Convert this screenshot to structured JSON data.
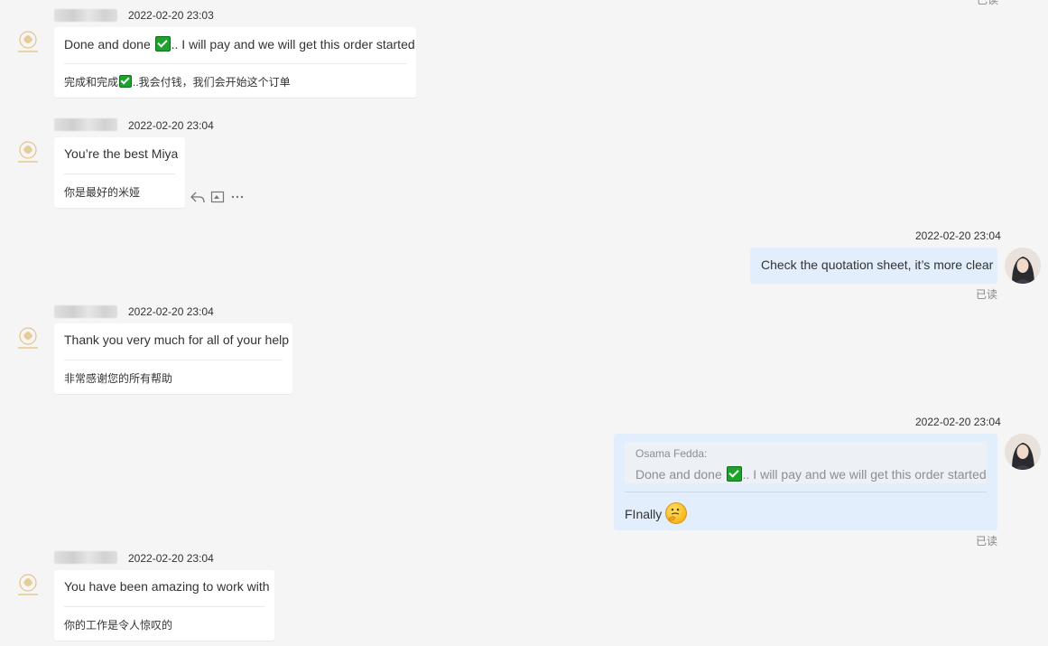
{
  "messages": [
    {
      "sender": "Osama Fedda",
      "time": "2022-02-20 23:03",
      "text_before": "Done and done ",
      "text_after": ".. I will pay and we will get this order started",
      "trans_before": "完成和完成",
      "trans_after": "..我会付钱，我们会开始这个订单"
    },
    {
      "time": "2022-02-20 23:04",
      "text": "You’re the best Miya",
      "trans": "你是最好的米娅"
    },
    {
      "time": "2022-02-20 23:04",
      "text": "Check the quotation sheet, it’s more clear",
      "status": "已读"
    },
    {
      "time": "2022-02-20 23:04",
      "text": "Thank you very much for all of your help",
      "trans": "非常感谢您的所有帮助"
    },
    {
      "time": "2022-02-20 23:04",
      "quote_name": "Osama Fedda:",
      "quote_before": "Done and done ",
      "quote_after": ".. I will pay and we will get this order started",
      "text": "FInally",
      "status": "已读"
    },
    {
      "time": "2022-02-20 23:04",
      "text": "You have been amazing to work with",
      "trans": "你的工作是令人惊叹的"
    }
  ],
  "top_status": "已读",
  "icons": {
    "reply": "reply-icon",
    "quote": "quote-icon",
    "more": "more-icon",
    "check": "check-mark-emoji",
    "thinking": "thinking-face-emoji"
  },
  "colors": {
    "page_bg": "#f5f5f5",
    "incoming_bubble": "#ffffff",
    "outgoing_bubble": "#e3eefc",
    "check_green": "#1ca32b"
  }
}
